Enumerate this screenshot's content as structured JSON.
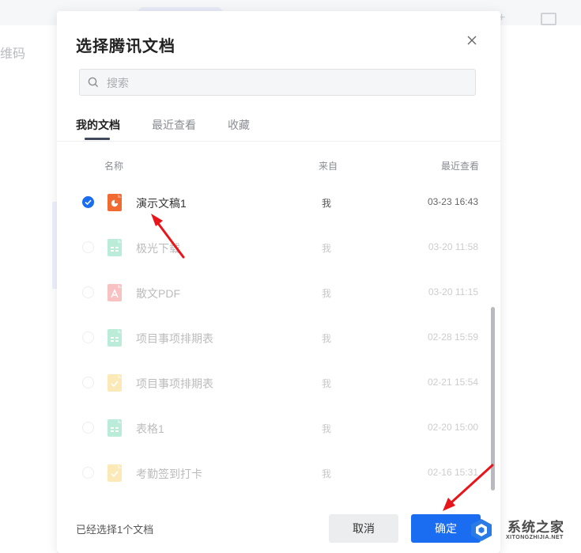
{
  "background": {
    "left_text": "维码"
  },
  "dialog": {
    "title": "选择腾讯文档",
    "search_placeholder": "搜索",
    "tabs": [
      {
        "label": "我的文档",
        "active": true
      },
      {
        "label": "最近查看",
        "active": false
      },
      {
        "label": "收藏",
        "active": false
      }
    ],
    "columns": {
      "name": "名称",
      "from": "来自",
      "recent": "最近查看"
    },
    "rows": [
      {
        "name": "演示文稿1",
        "from": "我",
        "time": "03-23 16:43",
        "selected": true,
        "icon": "slides-icon",
        "color": "#f06a32"
      },
      {
        "name": "极光下载",
        "from": "我",
        "time": "03-20 11:58",
        "selected": false,
        "icon": "sheet-icon",
        "color": "#34c38f"
      },
      {
        "name": "散文PDF",
        "from": "我",
        "time": "03-20 11:15",
        "selected": false,
        "icon": "pdf-icon",
        "color": "#ef4a4a"
      },
      {
        "name": "项目事项排期表",
        "from": "我",
        "time": "02-28 15:59",
        "selected": false,
        "icon": "sheet-icon",
        "color": "#34c38f"
      },
      {
        "name": "项目事项排期表",
        "from": "我",
        "time": "02-21 15:54",
        "selected": false,
        "icon": "form-icon",
        "color": "#f5c02c"
      },
      {
        "name": "表格1",
        "from": "我",
        "time": "02-20 15:00",
        "selected": false,
        "icon": "sheet-icon",
        "color": "#34c38f"
      },
      {
        "name": "考勤签到打卡",
        "from": "我",
        "time": "02-16 15:31",
        "selected": false,
        "icon": "form-icon",
        "color": "#f5c02c"
      }
    ],
    "footer": {
      "selected_text": "已经选择1个文档",
      "cancel_label": "取消",
      "ok_label": "确定"
    },
    "accent_color": "#1a6cf0"
  },
  "watermark": {
    "cn": "系统之家",
    "en": "XITONGZHIJIA.NET"
  }
}
